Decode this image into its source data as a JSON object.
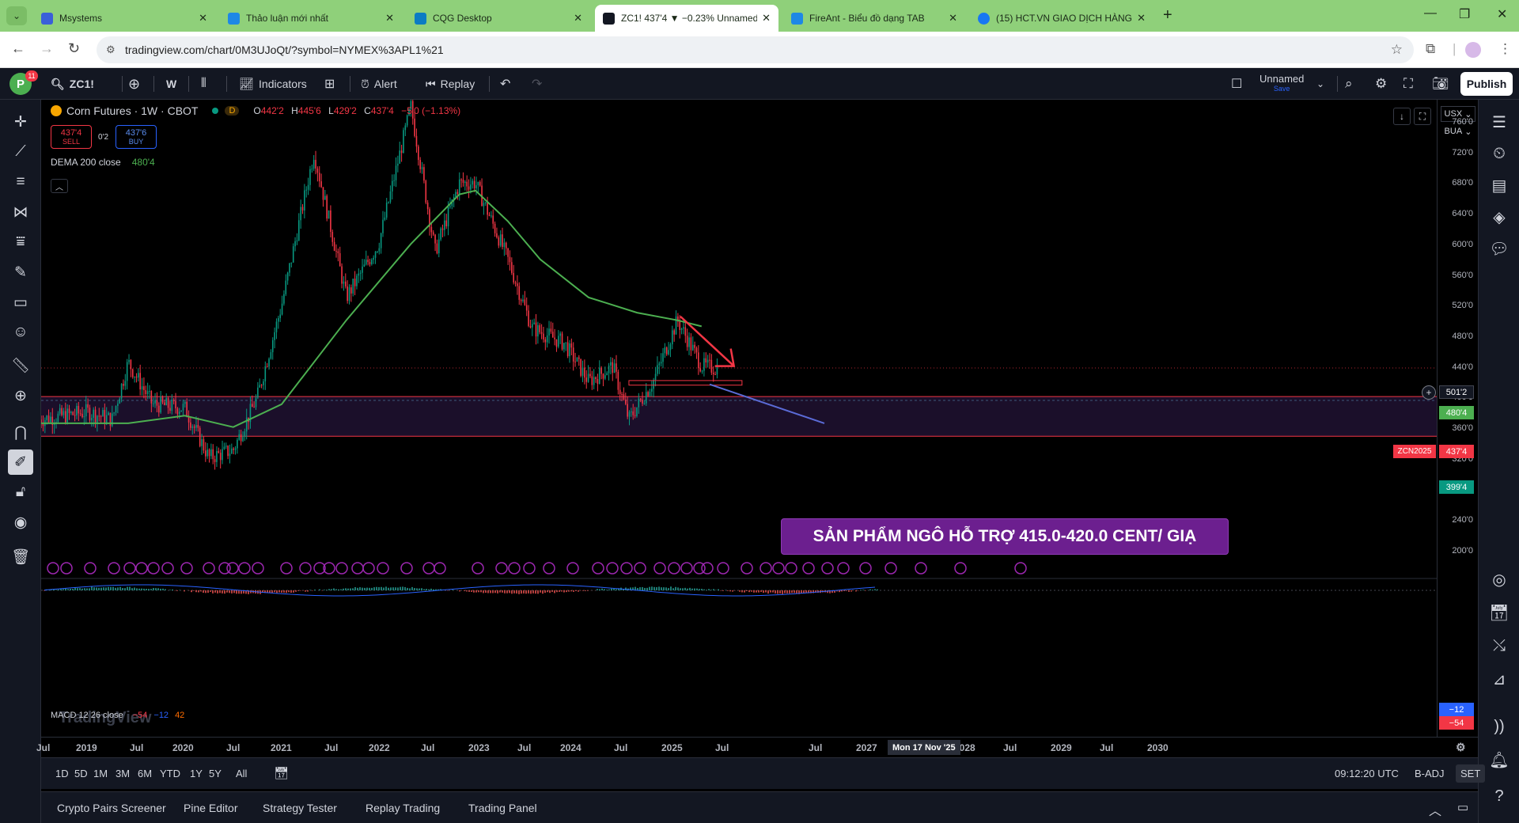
{
  "browser": {
    "tabs": [
      {
        "title": "Msystems",
        "active": false
      },
      {
        "title": "Thảo luận mới nhất",
        "active": false
      },
      {
        "title": "CQG Desktop",
        "active": false
      },
      {
        "title": "ZC1! 437'4 ▼ −0.23% Unnamed",
        "active": true
      },
      {
        "title": "FireAnt - Biểu đồ dạng TAB",
        "active": false
      },
      {
        "title": "(15) HCT.VN GIAO DỊCH HÀNG",
        "active": false
      }
    ],
    "url": "tradingview.com/chart/0M3UJoQt/?symbol=NYMEX%3APL1%21"
  },
  "toolbar": {
    "avatar_letter": "P",
    "notification_count": "11",
    "symbol": "ZC1!",
    "interval": "W",
    "indicators": "Indicators",
    "alert": "Alert",
    "replay": "Replay",
    "layout_name": "Unnamed",
    "layout_sub": "Save",
    "publish": "Publish"
  },
  "legend": {
    "title": "Corn Futures · 1W · CBOT",
    "flag": "D",
    "o_label": "O",
    "o": "442'2",
    "h_label": "H",
    "h": "445'6",
    "l_label": "L",
    "l": "429'2",
    "c_label": "C",
    "c": "437'4",
    "change": "−5'0 (−1.13%)",
    "sell_price": "437'4",
    "sell_label": "SELL",
    "spread": "0'2",
    "buy_price": "437'6",
    "buy_label": "BUY",
    "indicator_name": "DEMA 200 close",
    "indicator_value": "480'4"
  },
  "macd": {
    "label": "MACD 12 26 close",
    "v1": "−54",
    "v2": "−12",
    "v3": "42",
    "watermark": "TradingView"
  },
  "price_scale": {
    "currency": "USX",
    "unit": "BUA",
    "ticks": [
      "760'0",
      "720'0",
      "680'0",
      "640'0",
      "600'0",
      "560'0",
      "520'0",
      "480'0",
      "440'0",
      "400'0",
      "360'0",
      "320'0",
      "280'0",
      "240'0",
      "200'0"
    ],
    "crosshair_price": "501'2",
    "dema_price": "480'4",
    "last_price": "437'4",
    "last_symbol": "ZCN2025",
    "support_price": "399'4",
    "macd_a": "−12",
    "macd_b": "−54"
  },
  "annotation": {
    "text": "SẢN PHẨM NGÔ HỖ TRỢ 415.0-420.0 CENT/ GIẠ"
  },
  "time_axis": {
    "labels": [
      "Jul",
      "2019",
      "Jul",
      "2020",
      "Jul",
      "2021",
      "Jul",
      "2022",
      "Jul",
      "2023",
      "Jul",
      "2024",
      "Jul",
      "2025",
      "Jul",
      "Jul",
      "2027",
      "Jul",
      "2028",
      "Jul",
      "2029",
      "Jul",
      "2030"
    ],
    "crosshair_date": "Mon 17 Nov '25"
  },
  "range_bar": {
    "ranges": [
      "1D",
      "5D",
      "1M",
      "3M",
      "6M",
      "YTD",
      "1Y",
      "5Y",
      "All"
    ],
    "clock": "09:12:20 UTC",
    "adj": "B-ADJ",
    "session": "SET"
  },
  "bottom_panel": {
    "tabs": [
      "Crypto Pairs Screener",
      "Pine Editor",
      "Strategy Tester",
      "Replay Trading",
      "Trading Panel"
    ]
  },
  "chart_data": {
    "type": "candlestick",
    "title": "Corn Futures · 1W · CBOT",
    "ylim": [
      180,
      780
    ],
    "series": [
      {
        "name": "price (approx. closes)",
        "x": [
          "2018-07",
          "2019-01",
          "2019-04",
          "2019-06",
          "2019-09",
          "2020-01",
          "2020-04",
          "2020-07",
          "2020-10",
          "2021-01",
          "2021-05",
          "2021-09",
          "2022-01",
          "2022-05",
          "2022-08",
          "2022-11",
          "2023-01",
          "2023-05",
          "2023-08",
          "2023-12",
          "2024-03",
          "2024-06",
          "2024-08",
          "2024-11",
          "2025-02",
          "2025-05",
          "2025-07"
        ],
        "y": [
          370,
          380,
          370,
          445,
          390,
          385,
          320,
          330,
          400,
          520,
          720,
          530,
          600,
          780,
          590,
          680,
          680,
          580,
          490,
          470,
          420,
          440,
          370,
          420,
          500,
          440,
          437
        ]
      },
      {
        "name": "DEMA 200 close",
        "x": [
          "2018-07",
          "2019-06",
          "2020-01",
          "2020-07",
          "2021-01",
          "2021-09",
          "2022-05",
          "2022-11",
          "2023-01",
          "2023-05",
          "2023-09",
          "2024-03",
          "2024-09",
          "2025-02",
          "2025-05"
        ],
        "y": [
          365,
          365,
          375,
          360,
          390,
          500,
          600,
          665,
          670,
          630,
          580,
          530,
          510,
          500,
          492
        ]
      }
    ],
    "support_zone": [
      348,
      400
    ]
  }
}
